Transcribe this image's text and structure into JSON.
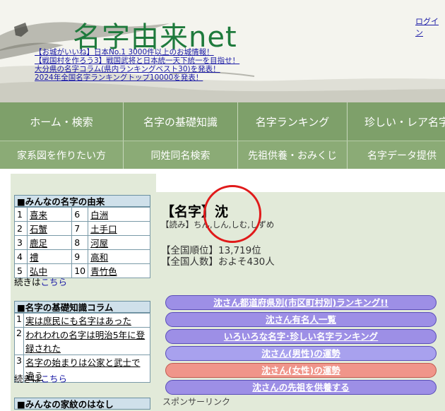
{
  "header": {
    "logo": "名字由来net",
    "login": "ログイン",
    "news": [
      "【お城がいいね】日本No.1 3000件以上のお城情報！",
      "【戦国村を作ろう3】戦国武将と日本統一天下統一を目指せ！",
      "大分県の名字コラム(県内ランキングベスト30)を発表！",
      "2024年全国名字ランキングトップ10000を発表！"
    ]
  },
  "nav": {
    "row1": [
      "ホーム・検索",
      "名字の基礎知識",
      "名字ランキング",
      "珍しい・レア名字"
    ],
    "row2": [
      "家系図を作りたい方",
      "同姓同名検索",
      "先祖供養・おみくじ",
      "名字データ提供"
    ]
  },
  "sidebar": {
    "ranking_title": "■みんなの名字の由来",
    "ranking": [
      {
        "n1": "1",
        "name1": "喜来",
        "n2": "6",
        "name2": "白洲"
      },
      {
        "n1": "2",
        "name1": "石蟹",
        "n2": "7",
        "name2": "土手口"
      },
      {
        "n1": "3",
        "name1": "鹿足",
        "n2": "8",
        "name2": "河屋"
      },
      {
        "n1": "4",
        "name1": "禮",
        "n2": "9",
        "name2": "高和"
      },
      {
        "n1": "5",
        "name1": "弘中",
        "n2": "10",
        "name2": "青竹色"
      }
    ],
    "more_prefix": "続きは",
    "more_link": "こちら",
    "column_title": "■名字の基礎知識コラム",
    "columns": [
      {
        "n": "1",
        "text": "実は庶民にも名字はあった"
      },
      {
        "n": "2",
        "text": "われわれの名字は明治5年に登録された"
      },
      {
        "n": "3",
        "text": "名字の始まりは公家と武士で違う"
      }
    ],
    "crest_title": "■みんなの家紋のはなし"
  },
  "main": {
    "title": "【名字】沈",
    "reading": "【読み】ちん,しん,しむ,しずめ",
    "rank_label": "【全国順位】",
    "rank_value": "13,719位",
    "count_label": "【全国人数】",
    "count_value": "およそ430人",
    "buttons": [
      "沈さん都道府県別(市区町村別)ランキング!!",
      "沈さん有名人一覧",
      "いろいろな名字･珍しい名字ランキング",
      "沈さん(男性)の運勢",
      "沈さん(女性)の運勢",
      "沈さんの先祖を供養する"
    ],
    "sponsor": "スポンサーリンク"
  },
  "colors": {
    "nav": "#7ea06a",
    "panel": "#e2ead9",
    "pill": "#9d8fe6",
    "pill_female": "#f0958a",
    "logo": "#1e7a3c",
    "highlight_circle": "#e01a1a"
  }
}
